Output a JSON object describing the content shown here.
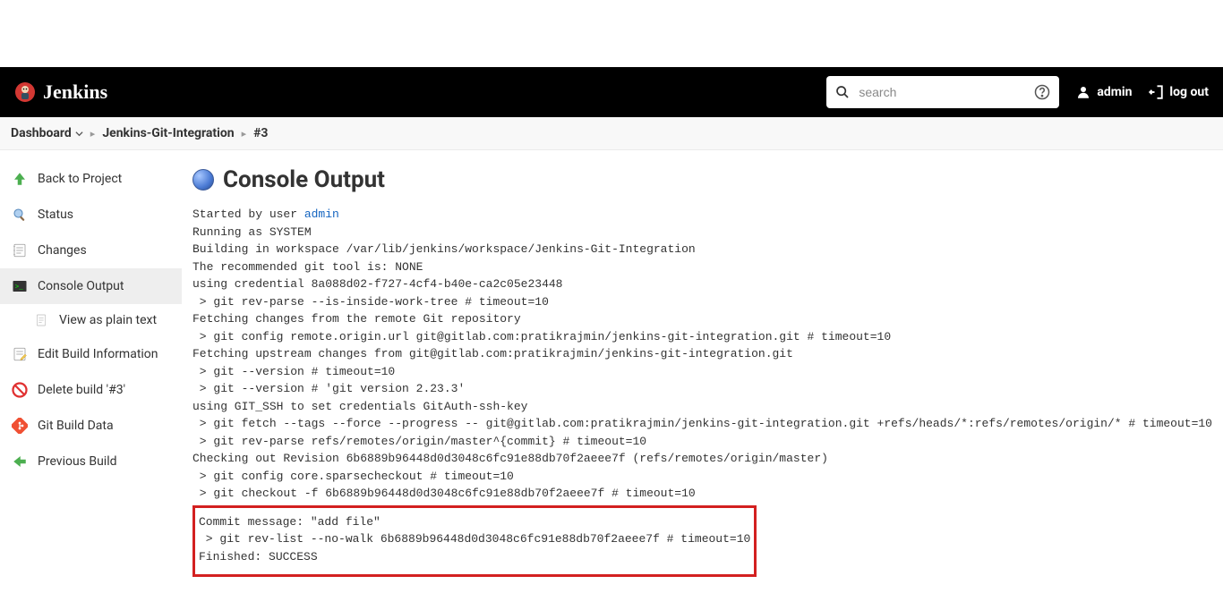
{
  "header": {
    "brand": "Jenkins",
    "search_placeholder": "search",
    "user": "admin",
    "logout": "log out"
  },
  "breadcrumb": {
    "items": [
      "Dashboard",
      "Jenkins-Git-Integration",
      "#3"
    ]
  },
  "sidebar": {
    "back": "Back to Project",
    "status": "Status",
    "changes": "Changes",
    "console": "Console Output",
    "view_plain": "View as plain text",
    "edit_info": "Edit Build Information",
    "delete": "Delete build '#3'",
    "git_data": "Git Build Data",
    "prev": "Previous Build"
  },
  "main": {
    "title": "Console Output",
    "started_prefix": "Started by user ",
    "started_user": "admin",
    "lines_before": "Running as SYSTEM\nBuilding in workspace /var/lib/jenkins/workspace/Jenkins-Git-Integration\nThe recommended git tool is: NONE\nusing credential 8a088d02-f727-4cf4-b40e-ca2c05e23448\n > git rev-parse --is-inside-work-tree # timeout=10\nFetching changes from the remote Git repository\n > git config remote.origin.url git@gitlab.com:pratikrajmin/jenkins-git-integration.git # timeout=10\nFetching upstream changes from git@gitlab.com:pratikrajmin/jenkins-git-integration.git\n > git --version # timeout=10\n > git --version # 'git version 2.23.3'\nusing GIT_SSH to set credentials GitAuth-ssh-key\n > git fetch --tags --force --progress -- git@gitlab.com:pratikrajmin/jenkins-git-integration.git +refs/heads/*:refs/remotes/origin/* # timeout=10\n > git rev-parse refs/remotes/origin/master^{commit} # timeout=10\nChecking out Revision 6b6889b96448d0d3048c6fc91e88db70f2aeee7f (refs/remotes/origin/master)\n > git config core.sparsecheckout # timeout=10\n > git checkout -f 6b6889b96448d0d3048c6fc91e88db70f2aeee7f # timeout=10",
    "highlight": "Commit message: \"add file\"\n > git rev-list --no-walk 6b6889b96448d0d3048c6fc91e88db70f2aeee7f # timeout=10\nFinished: SUCCESS"
  }
}
